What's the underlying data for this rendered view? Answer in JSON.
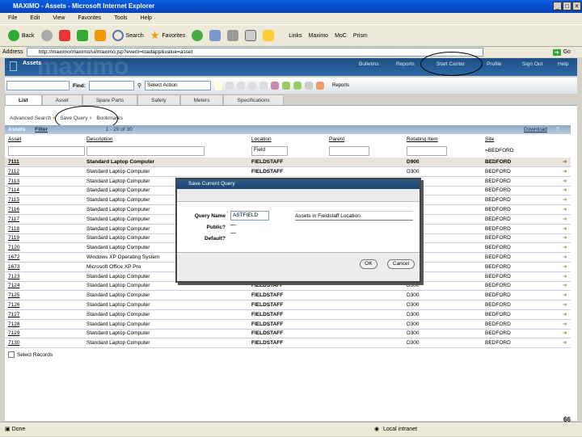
{
  "window": {
    "title": "MAXIMO - Assets - Microsoft Internet Explorer"
  },
  "menu": [
    "File",
    "Edit",
    "View",
    "Favorites",
    "Tools",
    "Help"
  ],
  "toolbar": {
    "back": "Back",
    "search": "Search",
    "favorites": "Favorites",
    "links": "Links",
    "link1": "Maximo",
    "link2": "MoC",
    "link3": "Prism"
  },
  "address": {
    "label": "Address",
    "url": "http://maximo/maximo/ui/maximo.jsp?event=loadapp&value=asset",
    "go": "Go"
  },
  "app": {
    "title": "Assets",
    "logo": "maximo",
    "nav": [
      "Bulletins",
      "Reports",
      "Start Center",
      "Profile",
      "Sign Out",
      "Help"
    ]
  },
  "apptoolbar": {
    "find_label": "Find:",
    "action_placeholder": "Select Action",
    "reports": "Reports"
  },
  "tabs": [
    "List",
    "Asset",
    "Spare Parts",
    "Safety",
    "Meters",
    "Specifications"
  ],
  "querybar": {
    "advanced": "Advanced Search",
    "save": "Save Query",
    "bookmarks": "Bookmarks"
  },
  "table": {
    "title": "Assets",
    "filter": "Filter",
    "paging": "1 - 20 of 30",
    "download": "Download",
    "columns": [
      "Asset",
      "Description",
      "Location",
      "Parent",
      "Rotating Item",
      "Site"
    ],
    "filters": {
      "location": "Field",
      "site": "=BEDFORD"
    },
    "rows": [
      [
        "7111",
        "Standard Laptop Computer",
        "FIELDSTAFF",
        "",
        "D900",
        "BEDFORD"
      ],
      [
        "7112",
        "Standard Laptop Computer",
        "FIELDSTAFF",
        "",
        "D300",
        "BEDFORD"
      ],
      [
        "7113",
        "Standard Laptop Computer",
        "",
        "",
        "",
        "BEDFORD"
      ],
      [
        "7114",
        "Standard Laptop Computer",
        "",
        "",
        "",
        "BEDFORD"
      ],
      [
        "7115",
        "Standard Laptop Computer",
        "",
        "",
        "",
        "BEDFORD"
      ],
      [
        "7116",
        "Standard Laptop Computer",
        "",
        "",
        "",
        "BEDFORD"
      ],
      [
        "7117",
        "Standard Laptop Computer",
        "",
        "",
        "",
        "BEDFORD"
      ],
      [
        "7118",
        "Standard Laptop Computer",
        "",
        "",
        "",
        "BEDFORD"
      ],
      [
        "7119",
        "Standard Laptop Computer",
        "",
        "",
        "",
        "BEDFORD"
      ],
      [
        "7120",
        "Standard Laptop Computer",
        "",
        "",
        "",
        "BEDFORD"
      ],
      [
        "1672",
        "Windows XP Operating System",
        "",
        "",
        "P",
        "BEDFORD"
      ],
      [
        "1673",
        "Microsoft Office XP Pro",
        "",
        "",
        "FICE",
        "BEDFORD"
      ],
      [
        "7123",
        "Standard Laptop Computer",
        "",
        "",
        "",
        "BEDFORD"
      ],
      [
        "7124",
        "Standard Laptop Computer",
        "FIELDSTAFF",
        "",
        "D300",
        "BEDFORD"
      ],
      [
        "7125",
        "Standard Laptop Computer",
        "FIELDSTAFF",
        "",
        "D300",
        "BEDFORD"
      ],
      [
        "7126",
        "Standard Laptop Computer",
        "FIELDSTAFF",
        "",
        "D300",
        "BEDFORD"
      ],
      [
        "7127",
        "Standard Laptop Computer",
        "FIELDSTAFF",
        "",
        "D300",
        "BEDFORD"
      ],
      [
        "7128",
        "Standard Laptop Computer",
        "FIELDSTAFF",
        "",
        "D300",
        "BEDFORD"
      ],
      [
        "7129",
        "Standard Laptop Computer",
        "FIELDSTAFF",
        "",
        "D300",
        "BEDFORD"
      ],
      [
        "7130",
        "Standard Laptop Computer",
        "FIELDSTAFF",
        "",
        "D300",
        "BEDFORD"
      ]
    ],
    "select_records": "Select Records"
  },
  "dialog": {
    "title": "Save Current Query",
    "query_label": "Query Name",
    "query_value": "ASTFIELD",
    "description": "Assets in Fieldstaff Location",
    "public_label": "Public?",
    "default_label": "Default?",
    "ok": "OK",
    "cancel": "Cancel"
  },
  "status": {
    "text": "Done",
    "zone": "Local intranet",
    "page_number": "66"
  }
}
